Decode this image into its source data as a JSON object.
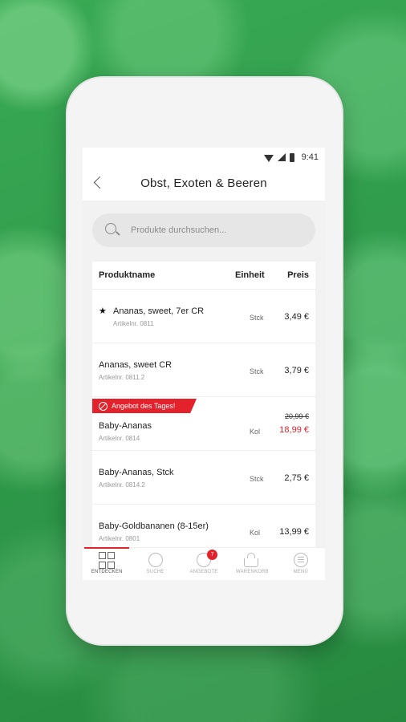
{
  "status_bar": {
    "time": "9:41"
  },
  "header": {
    "title": "Obst, Exoten & Beeren"
  },
  "search": {
    "placeholder": "Produkte durchsuchen..."
  },
  "table": {
    "headers": {
      "name": "Produktname",
      "unit": "Einheit",
      "price": "Preis"
    },
    "rows": [
      {
        "name": "Ananas, sweet, 7er CR",
        "sku": "Artikelnr. 0811",
        "unit": "Stck",
        "price": "3,49 €",
        "favorite": true
      },
      {
        "name": "Ananas, sweet CR",
        "sku": "Artikelnr. 0811.2",
        "unit": "Stck",
        "price": "3,79 €"
      },
      {
        "name": "Baby-Ananas",
        "sku": "Artikelnr. 0814",
        "unit": "Kol",
        "old_price": "20,99 €",
        "price": "18,99 €",
        "offer": "Angebot des Tages!"
      },
      {
        "name": "Baby-Ananas, Stck",
        "sku": "Artikelnr. 0814.2",
        "unit": "Stck",
        "price": "2,75 €"
      },
      {
        "name": "Baby-Goldbananen (8-15er)",
        "sku": "Artikelnr. 0801",
        "unit": "Kol",
        "price": "13,99 €"
      }
    ]
  },
  "tabbar": {
    "items": [
      {
        "label": "ENTDECKEN",
        "icon": "grid-icon",
        "active": true
      },
      {
        "label": "SUCHE",
        "icon": "search-icon"
      },
      {
        "label": "ANGEBOTE",
        "icon": "offers-icon",
        "badge": "7"
      },
      {
        "label": "WARENKORB",
        "icon": "basket-icon"
      },
      {
        "label": "MENÜ",
        "icon": "menu-icon"
      }
    ]
  },
  "colors": {
    "accent": "#e3222b",
    "background": "#2e9a47"
  }
}
